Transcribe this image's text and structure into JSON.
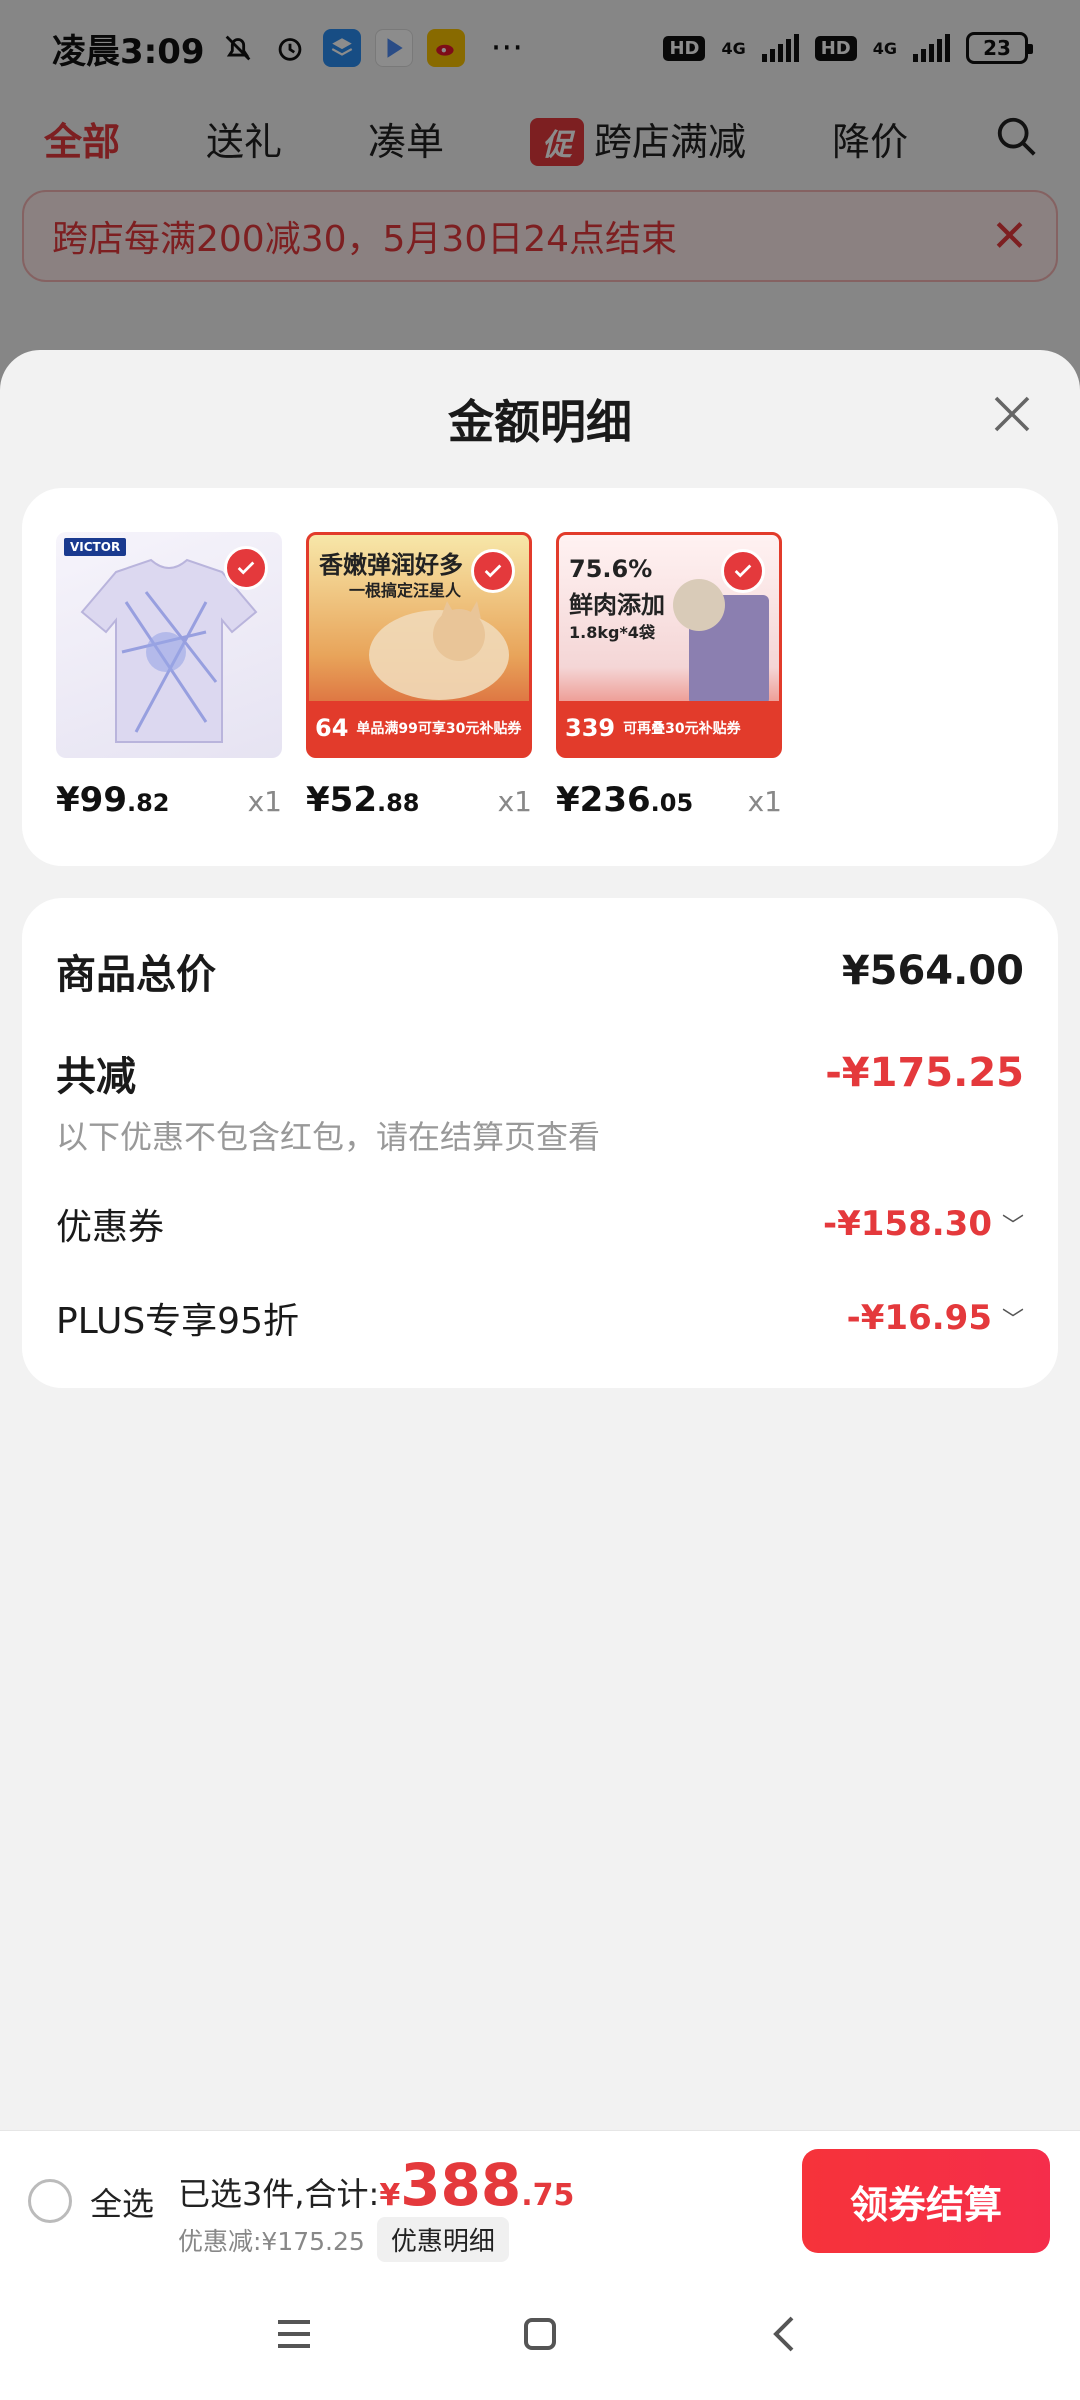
{
  "status_bar": {
    "time": "凌晨3:09",
    "more": "···",
    "network_type_1": "4G",
    "network_type_2": "4G",
    "hd_1": "HD",
    "hd_2": "HD",
    "battery": "23"
  },
  "tabs": [
    {
      "label": "全部",
      "active": true
    },
    {
      "label": "送礼"
    },
    {
      "label": "凑单"
    },
    {
      "label": "跨店满减",
      "badge": "促"
    },
    {
      "label": "降价"
    }
  ],
  "banner": {
    "text": "跨店每满200减30，5月30日24点结束",
    "close": "✕"
  },
  "sheet": {
    "title": "金额明细",
    "products": [
      {
        "price_main": "¥99",
        "price_dec": ".82",
        "qty": "x1",
        "brand": "VICTOR"
      },
      {
        "price_main": "¥52",
        "price_dec": ".88",
        "qty": "x1",
        "headline": "香嫩弹润好多",
        "subline": "一根搞定汪星人",
        "tag_price": "64",
        "tag_text": "单品满99可享30元补贴券"
      },
      {
        "price_main": "¥236",
        "price_dec": ".05",
        "qty": "x1",
        "headline": "75.6%",
        "headline2": "鲜肉添加",
        "subline": "1.8kg*4袋",
        "tag_price": "339",
        "tag_text": "可再叠30元补贴券"
      }
    ],
    "summary": {
      "total_label": "商品总价",
      "total_value": "¥564.00",
      "reduce_label": "共减",
      "reduce_value": "-¥175.25",
      "note": "以下优惠不包含红包，请在结算页查看",
      "coupon_label": "优惠券",
      "coupon_value": "-¥158.30",
      "plus_label": "PLUS专享95折",
      "plus_value": "-¥16.95"
    }
  },
  "footer": {
    "select_all": "全选",
    "selected_total_label": "已选3件,合计:",
    "currency": "¥",
    "total_int": "388",
    "total_dec": ".75",
    "discount_text": "优惠减:¥175.25",
    "detail_button": "优惠明细",
    "checkout_button": "领券结算"
  },
  "colors": {
    "accent": "#e4393c",
    "checkout": "#f6333a"
  }
}
